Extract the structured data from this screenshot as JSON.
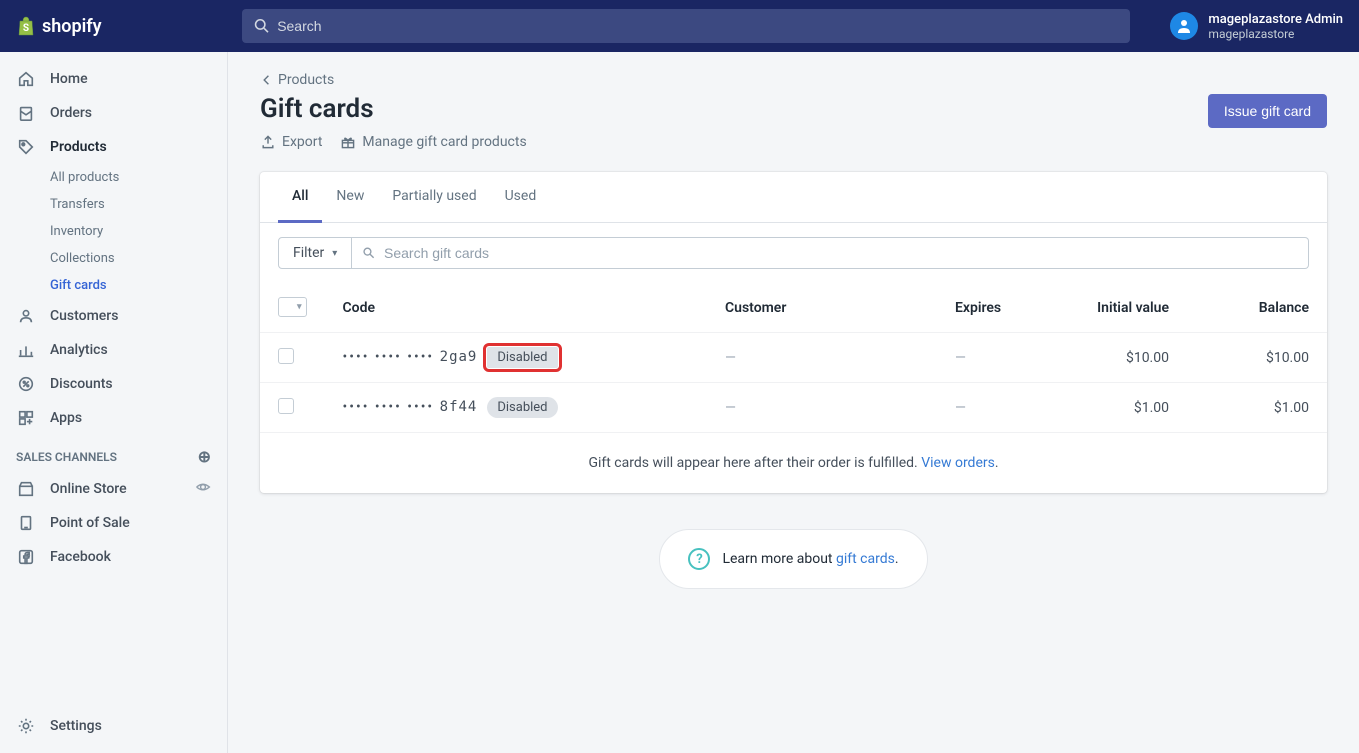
{
  "brand": "shopify",
  "search": {
    "placeholder": "Search"
  },
  "user": {
    "name": "mageplazastore Admin",
    "store": "mageplazastore"
  },
  "sidebar": {
    "items": [
      {
        "label": "Home"
      },
      {
        "label": "Orders"
      },
      {
        "label": "Products"
      },
      {
        "label": "Customers"
      },
      {
        "label": "Analytics"
      },
      {
        "label": "Discounts"
      },
      {
        "label": "Apps"
      }
    ],
    "sub": [
      {
        "label": "All products"
      },
      {
        "label": "Transfers"
      },
      {
        "label": "Inventory"
      },
      {
        "label": "Collections"
      },
      {
        "label": "Gift cards"
      }
    ],
    "section_title": "SALES CHANNELS",
    "channels": [
      {
        "label": "Online Store"
      },
      {
        "label": "Point of Sale"
      },
      {
        "label": "Facebook"
      }
    ],
    "settings": "Settings"
  },
  "breadcrumb": "Products",
  "page_title": "Gift cards",
  "actions": {
    "export": "Export",
    "manage": "Manage gift card products",
    "issue": "Issue gift card"
  },
  "tabs": [
    "All",
    "New",
    "Partially used",
    "Used"
  ],
  "filter": {
    "label": "Filter",
    "search_placeholder": "Search gift cards"
  },
  "table": {
    "headers": {
      "code": "Code",
      "customer": "Customer",
      "expires": "Expires",
      "initial": "Initial value",
      "balance": "Balance"
    },
    "rows": [
      {
        "code_suffix": "2ga9",
        "badge": "Disabled",
        "badge_highlight": true,
        "customer": "—",
        "expires": "—",
        "initial": "$10.00",
        "balance": "$10.00"
      },
      {
        "code_suffix": "8f44",
        "badge": "Disabled",
        "badge_highlight": false,
        "customer": "—",
        "expires": "—",
        "initial": "$1.00",
        "balance": "$1.00"
      }
    ],
    "footer": {
      "text": "Gift cards will appear here after their order is fulfilled. ",
      "link": "View orders",
      "period": "."
    }
  },
  "learn": {
    "text": "Learn more about ",
    "link": "gift cards",
    "period": "."
  }
}
